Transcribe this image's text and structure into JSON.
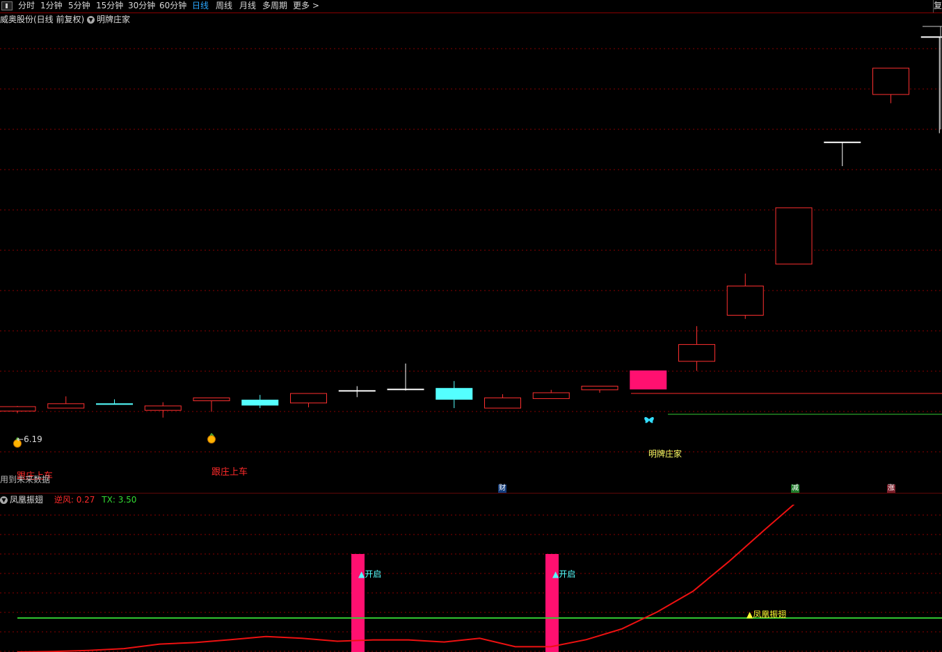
{
  "toolbar": {
    "tabs": [
      {
        "label": "分时"
      },
      {
        "label": "1分钟"
      },
      {
        "label": "5分钟"
      },
      {
        "label": "15分钟"
      },
      {
        "label": "30分钟"
      },
      {
        "label": "60分钟"
      },
      {
        "label": "日线",
        "active": true
      },
      {
        "label": "周线"
      },
      {
        "label": "月线"
      },
      {
        "label": "多周期"
      },
      {
        "label": "更多 >"
      }
    ],
    "right_edge_label": "复"
  },
  "main_panel": {
    "title": "威奥股份(日线 前复权)",
    "indicator_name": "明牌庄家",
    "price_label": "6.19",
    "signal_labels": {
      "follow_1": "跟庄上车",
      "follow_2": "跟庄上车",
      "future_data": "用到未来数据",
      "banker": "明牌庄家"
    },
    "badges": {
      "cai": "财",
      "jian": "减",
      "zhang": "涨"
    }
  },
  "sub_panel": {
    "indicator_name": "凤凰振翅",
    "param_nifeng_label": "逆风:",
    "param_nifeng_value": "0.27",
    "param_tx_label": "TX:",
    "param_tx_value": "3.50",
    "signal_open_1": "▲开启",
    "signal_open_2": "▲开启",
    "signal_phoenix": "▲凤凰振翅"
  },
  "colors": {
    "up": "#ff3030",
    "down": "#54ffff",
    "bg": "#000000",
    "grid": "#8b0000",
    "signal_bar": "#ff1070",
    "threshold": "#33cc33",
    "line": "#ee1111"
  },
  "chart_data": {
    "type": "candlestick",
    "candles": [
      {
        "open": 6.22,
        "close": 6.28,
        "high": 6.29,
        "low": 6.19,
        "dir": "up"
      },
      {
        "open": 6.26,
        "close": 6.32,
        "high": 6.42,
        "low": 6.26,
        "dir": "up"
      },
      {
        "open": 6.32,
        "close": 6.31,
        "high": 6.38,
        "low": 6.31,
        "dir": "down"
      },
      {
        "open": 6.23,
        "close": 6.29,
        "high": 6.34,
        "low": 6.13,
        "dir": "up"
      },
      {
        "open": 6.36,
        "close": 6.4,
        "high": 6.4,
        "low": 6.21,
        "dir": "up"
      },
      {
        "open": 6.3,
        "close": 6.37,
        "high": 6.44,
        "low": 6.26,
        "dir": "down"
      },
      {
        "open": 6.33,
        "close": 6.46,
        "high": 6.46,
        "low": 6.27,
        "dir": "up"
      },
      {
        "open": 6.5,
        "close": 6.5,
        "high": 6.56,
        "low": 6.41,
        "dir": "doji"
      },
      {
        "open": 6.52,
        "close": 6.52,
        "high": 6.87,
        "low": 6.5,
        "dir": "doji"
      },
      {
        "open": 6.53,
        "close": 6.38,
        "high": 6.63,
        "low": 6.26,
        "dir": "down"
      },
      {
        "open": 6.26,
        "close": 6.4,
        "high": 6.45,
        "low": 6.26,
        "dir": "up"
      },
      {
        "open": 6.39,
        "close": 6.47,
        "high": 6.51,
        "low": 6.39,
        "dir": "up"
      },
      {
        "open": 6.51,
        "close": 6.56,
        "high": 6.56,
        "low": 6.47,
        "dir": "up"
      },
      {
        "open": 6.52,
        "close": 6.77,
        "high": 6.77,
        "low": 6.52,
        "dir": "up-filled"
      },
      {
        "open": 6.9,
        "close": 7.13,
        "high": 7.38,
        "low": 6.77,
        "dir": "up"
      },
      {
        "open": 7.53,
        "close": 7.93,
        "high": 8.1,
        "low": 7.48,
        "dir": "up"
      },
      {
        "open": 8.23,
        "close": 9.0,
        "high": 9.0,
        "low": 8.23,
        "dir": "up"
      },
      {
        "open": 9.9,
        "close": 9.9,
        "high": 9.9,
        "low": 9.57,
        "dir": "doji"
      },
      {
        "open": 10.55,
        "close": 10.91,
        "high": 10.91,
        "low": 10.43,
        "dir": "up"
      },
      {
        "open": 11.34,
        "close": 11.34,
        "high": 11.34,
        "low": 10.02,
        "dir": "doji"
      }
    ],
    "price_min": 5.7,
    "price_max": 11.5,
    "sub_indicator": {
      "line_values": [
        0,
        0.2,
        0.6,
        1.3,
        3.0,
        3.6,
        4.7,
        5.9,
        5.2,
        4.1,
        4.6,
        4.6,
        3.8,
        5.2,
        2.0,
        2.0,
        4.7,
        8.8,
        15.3,
        23.1
      ],
      "extra_line_values": [
        34.3,
        46.3,
        58.0,
        68.7,
        79.4,
        89.5,
        97.0
      ],
      "threshold": 12.9,
      "open_signal_indices": [
        7,
        11
      ],
      "ymin": 0,
      "ymax": 56
    }
  }
}
